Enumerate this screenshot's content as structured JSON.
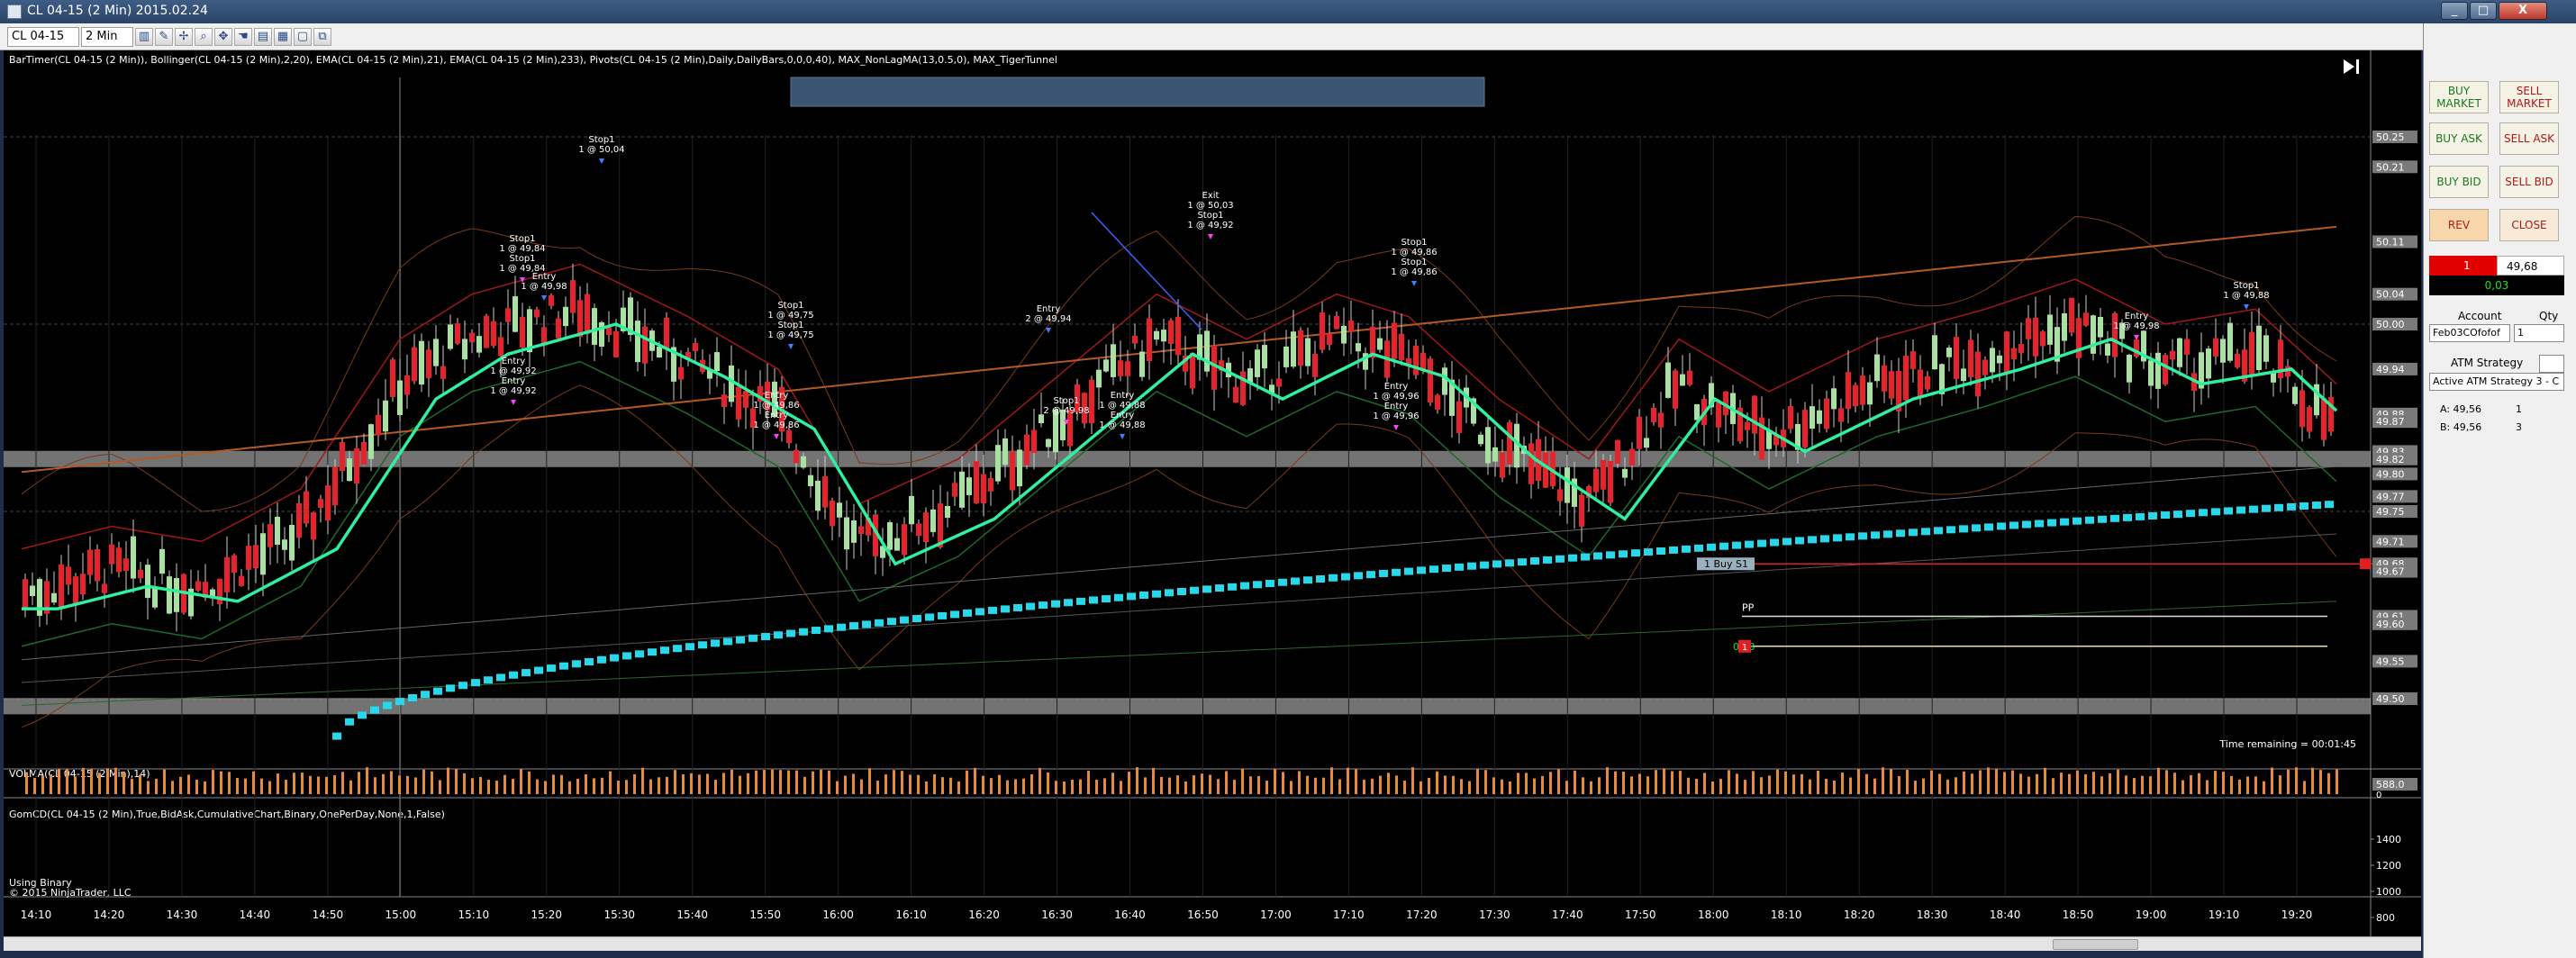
{
  "window": {
    "title": "CL 04-15 (2 Min)  2015.02.24",
    "min_label": "_",
    "max_label": "□",
    "close_label": "X"
  },
  "toolbar": {
    "instrument": "CL 04-15",
    "interval": "2 Min",
    "icons": [
      "bar-style-icon",
      "pencil-icon",
      "crosshair-icon",
      "zoom-icon",
      "properties-icon",
      "hand-icon",
      "indicators-icon",
      "strategy-icon",
      "window-icon",
      "copy-icon"
    ]
  },
  "chart": {
    "indicator_header": "BarTimer(CL 04-15 (2 Min)), Bollinger(CL 04-15 (2 Min),2,20), EMA(CL 04-15 (2 Min),21), EMA(CL 04-15 (2 Min),233), Pivots(CL 04-15 (2 Min),Daily,DailyBars,0,0,0,40), MAX_NonLagMA(13,0.5,0), MAX_TigerTunnel",
    "time_remaining": "Time remaining = 00:01:45",
    "volume_header": "VOLMA(CL 04-15 (2 Min),14)",
    "gomcd_header": "GomCD(CL 04-15 (2 Min),True,BidAsk,CumulativeChart,Binary,OnePerDay,None,1,False)",
    "using_binary": "Using Binary",
    "copyright": "© 2015 NinjaTrader, LLC",
    "buy_s1_label": "1  Buy S1",
    "pp_label": "PP",
    "order_pnl": "0.03",
    "order_qty": "1",
    "volume_axis": [
      "588.0",
      "0"
    ],
    "gomcd_axis": [
      "1400",
      "1200",
      "1000",
      "800"
    ],
    "price_axis": [
      "50.25",
      "50.21",
      "50.11",
      "50.04",
      "50.00",
      "49.94",
      "49.88",
      "49.87",
      "49.83",
      "49.82",
      "49.80",
      "49.77",
      "49.75",
      "49.71",
      "49.68",
      "49.67",
      "49.61",
      "49.60",
      "49.55",
      "49.50"
    ],
    "time_axis": [
      "14:10",
      "14:20",
      "14:30",
      "14:40",
      "14:50",
      "15:00",
      "15:10",
      "15:20",
      "15:30",
      "15:40",
      "15:50",
      "16:00",
      "16:10",
      "16:20",
      "16:30",
      "16:40",
      "16:50",
      "17:00",
      "17:10",
      "17:20",
      "17:30",
      "17:40",
      "17:50",
      "18:00",
      "18:10",
      "18:20",
      "18:30",
      "18:40",
      "18:50",
      "19:00",
      "19:10",
      "19:20"
    ],
    "trade_markers": [
      {
        "text": [
          "Stop1",
          "1 @ 50,04"
        ]
      },
      {
        "text": [
          "Stop1",
          "1 @ 49,84",
          "Stop1",
          "1 @ 49,84"
        ]
      },
      {
        "text": [
          "Entry",
          "1 @ 49,98"
        ]
      },
      {
        "text": [
          "Entry",
          "1 @ 49,92",
          "Entry",
          "1 @ 49,92"
        ]
      },
      {
        "text": [
          "Stop1",
          "1 @ 49,75",
          "Stop1",
          "1 @ 49,75"
        ]
      },
      {
        "text": [
          "Entry",
          "1 @ 49,86",
          "Entry",
          "1 @ 49,86"
        ]
      },
      {
        "text": [
          "Entry",
          "2 @ 49,94"
        ]
      },
      {
        "text": [
          "Stop1",
          "2 @ 49,98"
        ]
      },
      {
        "text": [
          "Entry",
          "1 @ 49,88",
          "Entry",
          "1 @ 49,88"
        ]
      },
      {
        "text": [
          "Exit",
          "1 @ 50,03",
          "Stop1",
          "1 @ 49,92"
        ]
      },
      {
        "text": [
          "Stop1",
          "1 @ 49,86",
          "Stop1",
          "1 @ 49,86"
        ]
      },
      {
        "text": [
          "Entry",
          "1 @ 49,96",
          "Entry",
          "1 @ 49,96"
        ]
      },
      {
        "text": [
          "Stop1",
          "1 @ 49,88"
        ]
      },
      {
        "text": [
          "Entry",
          "1 @ 49,98"
        ]
      }
    ]
  },
  "panel": {
    "buy_market": "BUY MARKET",
    "sell_market": "SELL MARKET",
    "buy_ask": "BUY ASK",
    "sell_ask": "SELL ASK",
    "buy_bid": "BUY BID",
    "sell_bid": "SELL BID",
    "rev": "REV",
    "close": "CLOSE",
    "position_qty": "1",
    "position_price": "49,68",
    "position_pnl": "0,03",
    "account_label": "Account",
    "account_value": "Feb03COfofof",
    "qty_label": "Qty",
    "qty_value": "1",
    "atm_label": "ATM Strategy",
    "atm_value": "Active ATM Strategy 3 - C",
    "ask_label": "A: 49,56",
    "ask_size": "1",
    "bid_label": "B: 49,56",
    "bid_size": "3"
  },
  "colors": {
    "up_candle": "#a8e2a0",
    "down_candle": "#e8222a",
    "ema21": "#2ef0a0",
    "tiger_dots": "#27d8ea",
    "volume": "#e88a3c"
  }
}
